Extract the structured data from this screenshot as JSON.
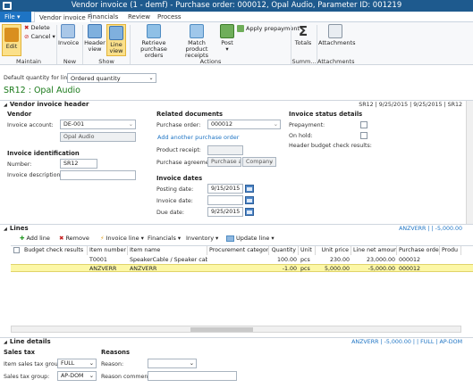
{
  "title": "Vendor invoice (1 - demf) - Purchase order: 000012, Opal Audio, Parameter ID: 001219",
  "tabs": [
    "File",
    "Vendor invoice",
    "Financials",
    "Review",
    "Process"
  ],
  "ribbon": {
    "edit": "Edit",
    "delete": "Delete",
    "cancel": "Cancel",
    "invoice": "Invoice",
    "header_view": "Header view",
    "line_view": "Line view",
    "retrieve": "Retrieve purchase orders",
    "match": "Match product receipts",
    "post": "Post",
    "apply_prepay": "Apply prepayment",
    "totals": "Totals",
    "attachments": "Attachments",
    "groups": [
      "Maintain",
      "New",
      "Show",
      "Actions",
      "Summ...",
      "Attachments"
    ]
  },
  "default_qty": {
    "label": "Default quantity for lines:",
    "value": "Ordered quantity"
  },
  "subtitle": "SR12 : Opal Audio",
  "header": {
    "section": "Vendor invoice header",
    "status": "SR12  |  9/25/2015  |  9/25/2015  |  SR12",
    "vendor_title": "Vendor",
    "invoice_account_label": "Invoice account:",
    "invoice_account": "DE-001",
    "vendor_name": "Opal Audio",
    "ident_title": "Invoice identification",
    "number_label": "Number:",
    "number": "SR12",
    "desc_label": "Invoice description:",
    "desc": "",
    "related_title": "Related documents",
    "po_label": "Purchase order:",
    "po": "000012",
    "add_po": "Add another purchase order",
    "receipt_label": "Product receipt:",
    "agreement_label": "Purchase agreement:",
    "agreement_a": "Purchase a",
    "agreement_b": "Company",
    "dates_title": "Invoice dates",
    "posting_label": "Posting date:",
    "posting": "9/15/2015",
    "invdate_label": "Invoice date:",
    "invdate": "",
    "due_label": "Due date:",
    "due": "9/25/2015",
    "status_title": "Invoice status details",
    "prepay_label": "Prepayment:",
    "onhold_label": "On hold:",
    "budget_label": "Header budget check results:"
  },
  "lines": {
    "section": "Lines",
    "status": "ANZVERR  |    |  -5,000.00",
    "toolbar": [
      "Add line",
      "Remove",
      "Invoice line",
      "Financials",
      "Inventory",
      "Update line"
    ],
    "columns": [
      "Budget check results",
      "Item number",
      "Item name",
      "Procurement category",
      "Quantity",
      "Unit",
      "Unit price",
      "Line net amount",
      "Purchase order",
      "Produ"
    ],
    "rows": [
      [
        "",
        "T0001",
        "SpeakerCable / Speaker cable...",
        "",
        "100.00",
        "pcs",
        "230.00",
        "23,000.00",
        "000012",
        ""
      ],
      [
        "",
        "ANZVERR",
        "ANZVERR",
        "",
        "-1.00",
        "pcs",
        "5,000.00",
        "-5,000.00",
        "000012",
        ""
      ]
    ]
  },
  "details": {
    "section": "Line details",
    "status": "ANZVERR  |  -5,000.00  |    |  FULL  |  AP-DOM",
    "salestax_title": "Sales tax",
    "item_tax_label": "Item sales tax group:",
    "item_tax": "FULL",
    "tax_label": "Sales tax group:",
    "tax": "AP-DOM",
    "reasons_title": "Reasons",
    "reason_label": "Reason:",
    "comment_label": "Reason comment:"
  },
  "colors": {
    "titlebar": "#1e5a8e",
    "accent": "#1e74c4",
    "highlight": "#fcf7a6",
    "green": "#1a7a1a"
  }
}
